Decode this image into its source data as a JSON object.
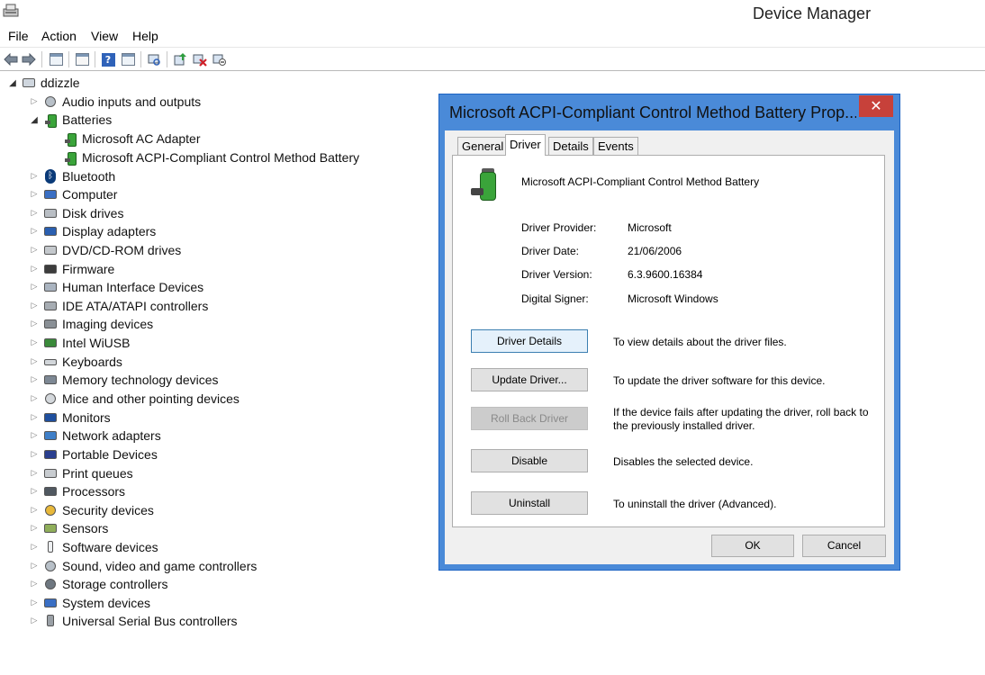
{
  "window": {
    "title": "Device Manager"
  },
  "menu": [
    "File",
    "Action",
    "View",
    "Help"
  ],
  "toolbar": {
    "icons": [
      "back-arrow-icon",
      "forward-arrow-icon",
      "show-hide-console-tree-icon",
      "properties-icon",
      "help-icon",
      "view-icon",
      "scan-hardware-icon",
      "update-driver-icon",
      "uninstall-device-icon",
      "disable-device-icon"
    ]
  },
  "tree": {
    "root": "ddizzle",
    "batteries_children": [
      "Microsoft AC Adapter",
      "Microsoft ACPI-Compliant Control Method Battery"
    ],
    "categories": [
      "Audio inputs and outputs",
      "Batteries",
      "Bluetooth",
      "Computer",
      "Disk drives",
      "Display adapters",
      "DVD/CD-ROM drives",
      "Firmware",
      "Human Interface Devices",
      "IDE ATA/ATAPI controllers",
      "Imaging devices",
      "Intel WiUSB",
      "Keyboards",
      "Memory technology devices",
      "Mice and other pointing devices",
      "Monitors",
      "Network adapters",
      "Portable Devices",
      "Print queues",
      "Processors",
      "Security devices",
      "Sensors",
      "Software devices",
      "Sound, video and game controllers",
      "Storage controllers",
      "System devices",
      "Universal Serial Bus controllers"
    ]
  },
  "dialog": {
    "title": "Microsoft ACPI-Compliant Control Method Battery Prop...",
    "close_glyph": "✕",
    "tabs": [
      "General",
      "Driver",
      "Details",
      "Events"
    ],
    "active_tab": "Driver",
    "device_name": "Microsoft ACPI-Compliant Control Method Battery",
    "properties": {
      "provider_label": "Driver Provider:",
      "provider_value": "Microsoft",
      "date_label": "Driver Date:",
      "date_value": "21/06/2006",
      "version_label": "Driver Version:",
      "version_value": "6.3.9600.16384",
      "signer_label": "Digital Signer:",
      "signer_value": "Microsoft Windows"
    },
    "actions": {
      "details_label": "Driver Details",
      "details_desc": "To view details about the driver files.",
      "update_label": "Update Driver...",
      "update_desc": "To update the driver software for this device.",
      "rollback_label": "Roll Back Driver",
      "rollback_desc": "If the device fails after updating the driver, roll back to the previously installed driver.",
      "disable_label": "Disable",
      "disable_desc": "Disables the selected device.",
      "uninstall_label": "Uninstall",
      "uninstall_desc": "To uninstall the driver (Advanced)."
    },
    "ok_label": "OK",
    "cancel_label": "Cancel"
  }
}
